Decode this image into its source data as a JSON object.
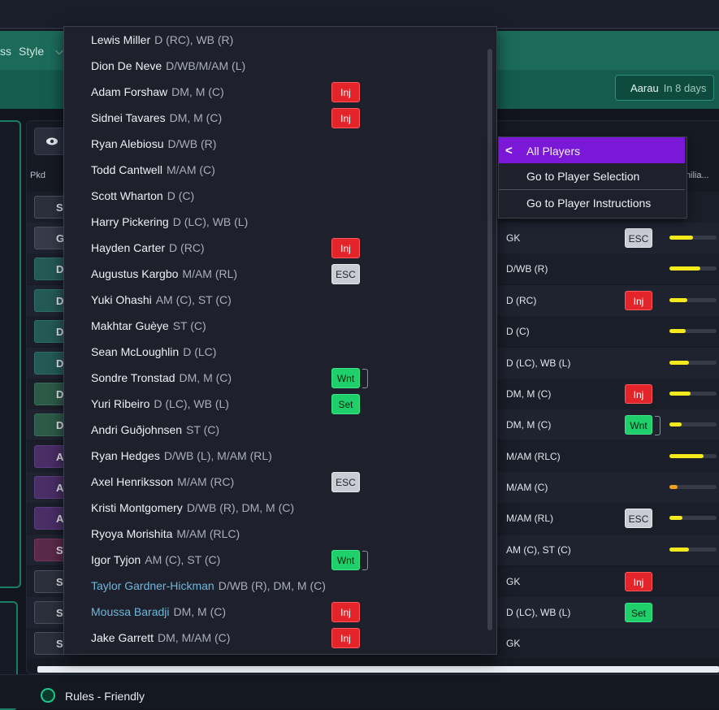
{
  "topbar": {
    "tab_partial": "ss",
    "style_label": "Style"
  },
  "fixture": {
    "team": "Aarau",
    "when": "In 8 days"
  },
  "table": {
    "col_pkd": "Pkd",
    "col_familiarity": "Familia..."
  },
  "rows": [
    {
      "pkd": "S",
      "pos": "",
      "badge": "",
      "bar": 0
    },
    {
      "pkd": "G",
      "pos": "GK",
      "badge": "ESC",
      "bar": 0.5
    },
    {
      "pkd": "D",
      "pos": "D/WB (R)",
      "badge": "",
      "bar": 0.65
    },
    {
      "pkd": "D",
      "pos": "D (RC)",
      "badge": "Inj",
      "bar": 0.38
    },
    {
      "pkd": "D",
      "pos": "D (C)",
      "badge": "",
      "bar": 0.35
    },
    {
      "pkd": "D",
      "pos": "D (LC), WB (L)",
      "badge": "",
      "bar": 0.42
    },
    {
      "pkd": "D",
      "pos": "DM, M (C)",
      "badge": "Inj",
      "bar": 0.45
    },
    {
      "pkd": "D",
      "pos": "DM, M (C)",
      "badge": "Wnt",
      "bar": 0.25
    },
    {
      "pkd": "AM",
      "pos": "M/AM (RLC)",
      "badge": "",
      "bar": 0.72
    },
    {
      "pkd": "AM",
      "pos": "M/AM (C)",
      "badge": "",
      "bar": 0.18
    },
    {
      "pkd": "AM",
      "pos": "M/AM (RL)",
      "badge": "ESC",
      "bar": 0.28
    },
    {
      "pkd": "ST",
      "pos": "AM (C), ST (C)",
      "badge": "",
      "bar": 0.42
    },
    {
      "pkd": "S",
      "pos": "GK",
      "badge": "Inj",
      "bar": 0
    },
    {
      "pkd": "S",
      "pos": "D (LC), WB (L)",
      "badge": "Set",
      "bar": 0
    },
    {
      "pkd": "S",
      "pos": "GK",
      "badge": "",
      "bar": 0
    }
  ],
  "players": [
    {
      "name": "Lewis Miller",
      "pos": "D (RC), WB (R)",
      "badge": ""
    },
    {
      "name": "Dion De Neve",
      "pos": "D/WB/M/AM (L)",
      "badge": ""
    },
    {
      "name": "Adam Forshaw",
      "pos": "DM, M (C)",
      "badge": "Inj"
    },
    {
      "name": "Sidnei Tavares",
      "pos": "DM, M (C)",
      "badge": "Inj"
    },
    {
      "name": "Ryan Alebiosu",
      "pos": "D/WB (R)",
      "badge": ""
    },
    {
      "name": "Todd Cantwell",
      "pos": "M/AM (C)",
      "badge": ""
    },
    {
      "name": "Scott Wharton",
      "pos": "D (C)",
      "badge": ""
    },
    {
      "name": "Harry Pickering",
      "pos": "D (LC), WB (L)",
      "badge": ""
    },
    {
      "name": "Hayden Carter",
      "pos": "D (RC)",
      "badge": "Inj"
    },
    {
      "name": "Augustus Kargbo",
      "pos": "M/AM (RL)",
      "badge": "ESC"
    },
    {
      "name": "Yuki Ohashi",
      "pos": "AM (C), ST (C)",
      "badge": ""
    },
    {
      "name": "Makhtar Guèye",
      "pos": "ST (C)",
      "badge": ""
    },
    {
      "name": "Sean McLoughlin",
      "pos": "D (LC)",
      "badge": ""
    },
    {
      "name": "Sondre Tronstad",
      "pos": "DM, M (C)",
      "badge": "Wnt"
    },
    {
      "name": "Yuri Ribeiro",
      "pos": "D (LC), WB (L)",
      "badge": "Set"
    },
    {
      "name": "Andri Guðjohnsen",
      "pos": "ST (C)",
      "badge": ""
    },
    {
      "name": "Ryan Hedges",
      "pos": "D/WB (L), M/AM (RL)",
      "badge": ""
    },
    {
      "name": "Axel Henriksson",
      "pos": "M/AM (RC)",
      "badge": "ESC"
    },
    {
      "name": "Kristi Montgomery",
      "pos": "D/WB (R), DM, M (C)",
      "badge": ""
    },
    {
      "name": "Ryoya Morishita",
      "pos": "M/AM (RLC)",
      "badge": ""
    },
    {
      "name": "Igor Tyjon",
      "pos": "AM (C), ST (C)",
      "badge": "Wnt"
    },
    {
      "name": "Taylor Gardner-Hickman",
      "pos": "D/WB (R), DM, M (C)",
      "badge": "",
      "link": true
    },
    {
      "name": "Moussa Baradji",
      "pos": "DM, M (C)",
      "badge": "Inj",
      "link": true
    },
    {
      "name": "Jake Garrett",
      "pos": "DM, M/AM (C)",
      "badge": "Inj"
    }
  ],
  "context_menu": {
    "header": "All Players",
    "item1": "Go to Player Selection",
    "item2": "Go to Player Instructions"
  },
  "footer": {
    "rules": "Rules - Friendly"
  },
  "colors": {
    "accent_purple": "#7b18d8",
    "brand_green": "#1c6b5a",
    "injury": "#e3242b",
    "wanted": "#1fcf6a"
  },
  "icons": [
    "eye-icon",
    "chevron-down-icon",
    "chevron-left-icon",
    "rules-icon"
  ]
}
